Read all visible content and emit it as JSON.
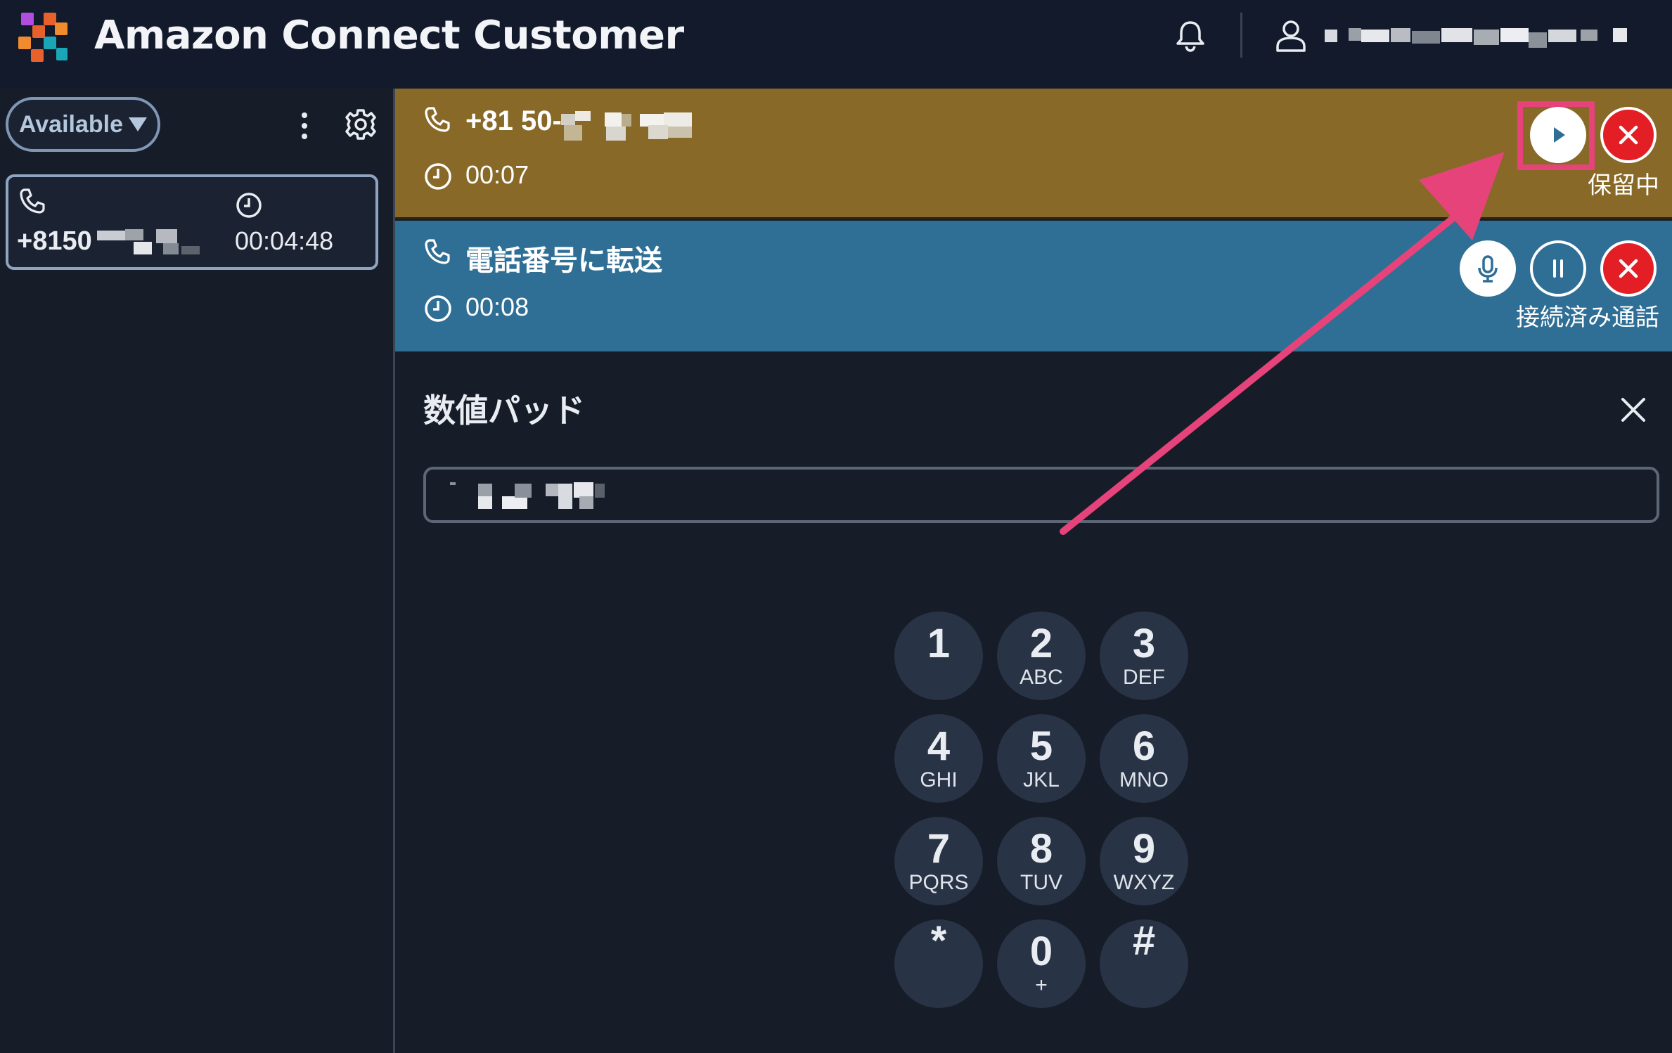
{
  "app": {
    "title": "Amazon Connect Customer"
  },
  "header": {
    "user_name": ""
  },
  "sidebar": {
    "status_label": "Available",
    "contact": {
      "number": "+8150",
      "duration": "00:04:48"
    }
  },
  "calls": [
    {
      "title": "+81 50-",
      "duration": "00:07",
      "state_label": "保留中",
      "color": "#886927"
    },
    {
      "title": "電話番号に転送",
      "duration": "00:08",
      "state_label": "接続済み通話",
      "color": "#2f6f96"
    }
  ],
  "numpad": {
    "title": "数値パッド",
    "input_value": "",
    "keys": [
      {
        "digit": "1",
        "letters": ""
      },
      {
        "digit": "2",
        "letters": "ABC"
      },
      {
        "digit": "3",
        "letters": "DEF"
      },
      {
        "digit": "4",
        "letters": "GHI"
      },
      {
        "digit": "5",
        "letters": "JKL"
      },
      {
        "digit": "6",
        "letters": "MNO"
      },
      {
        "digit": "7",
        "letters": "PQRS"
      },
      {
        "digit": "8",
        "letters": "TUV"
      },
      {
        "digit": "9",
        "letters": "WXYZ"
      },
      {
        "digit": "*",
        "letters": ""
      },
      {
        "digit": "0",
        "letters": "+"
      },
      {
        "digit": "#",
        "letters": ""
      }
    ]
  },
  "colors": {
    "accent_annotation": "#e6437a",
    "end_call_red": "#e31e24"
  }
}
